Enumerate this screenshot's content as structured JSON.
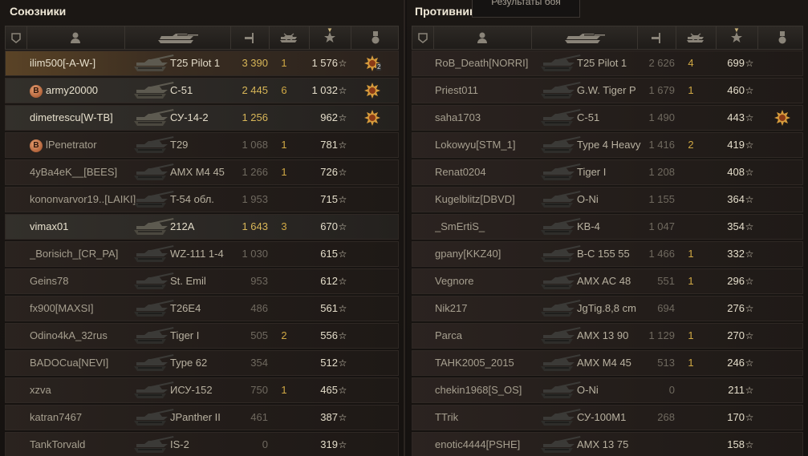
{
  "tooltip": "Результаты боя",
  "columns": [
    "squad-icon",
    "player-icon",
    "tank-icon",
    "damage-icon",
    "kills-icon",
    "xp-star-icon",
    "medal-icon"
  ],
  "allies": {
    "title": "Союзники",
    "rows": [
      {
        "name": "ilim500[-A-W-]",
        "tank": "T25 Pilot 1",
        "dmg": "3 390",
        "kills": "1",
        "xp": "1 576",
        "medal": true,
        "medal_count": "2",
        "style": "me",
        "gold": true,
        "badge": ""
      },
      {
        "name": "army20000",
        "tank": "C-51",
        "dmg": "2 445",
        "kills": "6",
        "xp": "1 032",
        "medal": true,
        "style": "alive",
        "gold": true,
        "badge": "B"
      },
      {
        "name": "dimetrescu[W-TB]",
        "tank": "СУ-14-2",
        "dmg": "1 256",
        "kills": "",
        "xp": "962",
        "medal": true,
        "style": "alive",
        "gold": true,
        "badge": ""
      },
      {
        "name": "lPenetrator",
        "tank": "T29",
        "dmg": "1 068",
        "kills": "1",
        "xp": "781",
        "medal": false,
        "style": "",
        "gold": false,
        "badge": "B"
      },
      {
        "name": "4yBa4eK__[BEES]",
        "tank": "AMX M4 45",
        "dmg": "1 266",
        "kills": "1",
        "xp": "726",
        "medal": false,
        "style": "",
        "gold": false,
        "badge": ""
      },
      {
        "name": "kononvarvor19..[LAIKI]",
        "tank": "T-54 обл.",
        "dmg": "1 953",
        "kills": "",
        "xp": "715",
        "medal": false,
        "style": "",
        "gold": false,
        "badge": ""
      },
      {
        "name": "vimax01",
        "tank": "212A",
        "dmg": "1 643",
        "kills": "3",
        "xp": "670",
        "medal": false,
        "style": "alive",
        "gold": true,
        "badge": ""
      },
      {
        "name": "_Borisich_[CR_PA]",
        "tank": "WZ-111 1-4",
        "dmg": "1 030",
        "kills": "",
        "xp": "615",
        "medal": false,
        "style": "",
        "gold": false,
        "badge": ""
      },
      {
        "name": "Geins78",
        "tank": "St. Emil",
        "dmg": "953",
        "kills": "",
        "xp": "612",
        "medal": false,
        "style": "",
        "gold": false,
        "badge": ""
      },
      {
        "name": "fx900[MAXSI]",
        "tank": "T26E4",
        "dmg": "486",
        "kills": "",
        "xp": "561",
        "medal": false,
        "style": "",
        "gold": false,
        "badge": ""
      },
      {
        "name": "Odino4kA_32rus",
        "tank": "Tiger I",
        "dmg": "505",
        "kills": "2",
        "xp": "556",
        "medal": false,
        "style": "",
        "gold": false,
        "badge": ""
      },
      {
        "name": "BADOCua[NEVI]",
        "tank": "Type 62",
        "dmg": "354",
        "kills": "",
        "xp": "512",
        "medal": false,
        "style": "",
        "gold": false,
        "badge": ""
      },
      {
        "name": "xzva",
        "tank": "ИСУ-152",
        "dmg": "750",
        "kills": "1",
        "xp": "465",
        "medal": false,
        "style": "",
        "gold": false,
        "badge": ""
      },
      {
        "name": "katran7467",
        "tank": "JPanther II",
        "dmg": "461",
        "kills": "",
        "xp": "387",
        "medal": false,
        "style": "",
        "gold": false,
        "badge": ""
      },
      {
        "name": "TankTorvald",
        "tank": "IS-2",
        "dmg": "0",
        "kills": "",
        "xp": "319",
        "medal": false,
        "style": "",
        "gold": false,
        "badge": ""
      }
    ]
  },
  "enemies": {
    "title": "Противник",
    "rows": [
      {
        "name": "RoB_Death[NORRI]",
        "tank": "T25 Pilot 1",
        "dmg": "2 626",
        "kills": "4",
        "xp": "699",
        "medal": false
      },
      {
        "name": "Priest011",
        "tank": "G.W. Tiger P",
        "dmg": "1 679",
        "kills": "1",
        "xp": "460",
        "medal": false
      },
      {
        "name": "saha1703",
        "tank": "C-51",
        "dmg": "1 490",
        "kills": "",
        "xp": "443",
        "medal": true
      },
      {
        "name": "Lokowyu[STM_1]",
        "tank": "Type 4 Heavy",
        "dmg": "1 416",
        "kills": "2",
        "xp": "419",
        "medal": false
      },
      {
        "name": "Renat0204",
        "tank": "Tiger I",
        "dmg": "1 208",
        "kills": "",
        "xp": "408",
        "medal": false
      },
      {
        "name": "Kugelblitz[DBVD]",
        "tank": "O-Ni",
        "dmg": "1 155",
        "kills": "",
        "xp": "364",
        "medal": false
      },
      {
        "name": "_SmErtiS_",
        "tank": "KB-4",
        "dmg": "1 047",
        "kills": "",
        "xp": "354",
        "medal": false
      },
      {
        "name": "gpany[KKZ40]",
        "tank": "B-C 155 55",
        "dmg": "1 466",
        "kills": "1",
        "xp": "332",
        "medal": false
      },
      {
        "name": "Vegnore",
        "tank": "AMX AC 48",
        "dmg": "551",
        "kills": "1",
        "xp": "296",
        "medal": false
      },
      {
        "name": "Nik217",
        "tank": "JgTig.8,8 cm",
        "dmg": "694",
        "kills": "",
        "xp": "276",
        "medal": false
      },
      {
        "name": "Parca",
        "tank": "AMX 13 90",
        "dmg": "1 129",
        "kills": "1",
        "xp": "270",
        "medal": false
      },
      {
        "name": "TAHK2005_2015",
        "tank": "AMX M4 45",
        "dmg": "513",
        "kills": "1",
        "xp": "246",
        "medal": false
      },
      {
        "name": "chekin1968[S_OS]",
        "tank": "O-Ni",
        "dmg": "0",
        "kills": "",
        "xp": "211",
        "medal": false
      },
      {
        "name": "TTrik",
        "tank": "СУ-100М1",
        "dmg": "268",
        "kills": "",
        "xp": "170",
        "medal": false
      },
      {
        "name": "enotic4444[PSHE]",
        "tank": "AMX 13 75",
        "dmg": "",
        "kills": "",
        "xp": "158",
        "medal": false
      }
    ]
  }
}
